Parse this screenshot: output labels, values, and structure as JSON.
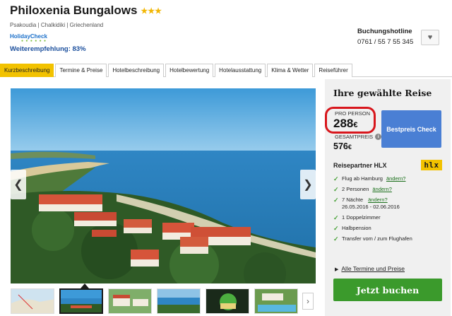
{
  "hotel": {
    "name": "Philoxenia Bungalows",
    "stars": "★★★",
    "location": "Psakoudia | Chalkidiki | Griechenland",
    "holidaycheck_logo": "HolidayCheck",
    "recommendation": "Weiterempfehlung: 83%"
  },
  "hotline": {
    "label": "Buchungshotline",
    "number": "0761 / 55 7 55 345"
  },
  "icons": {
    "favorite": "heart-icon",
    "prev": "chevron-left-icon",
    "next": "chevron-right-icon",
    "info": "info-icon",
    "check": "checkmark-icon"
  },
  "tabs": [
    {
      "label": "Kurzbeschreibung",
      "active": true
    },
    {
      "label": "Termine & Preise"
    },
    {
      "label": "Hotelbeschreibung"
    },
    {
      "label": "Hotelbewertung"
    },
    {
      "label": "Hotelausstattung"
    },
    {
      "label": "Klima & Wetter"
    },
    {
      "label": "Reiseführer"
    }
  ],
  "panel": {
    "title": "Ihre gewählte Reise",
    "per_person_label": "PRO PERSON",
    "per_person_price": "288",
    "currency": "€",
    "total_label": "GESAMTPREIS",
    "total_price": "576",
    "bestpreis_button": "Bestpreis Check",
    "partner": "Reisepartner HLX",
    "partner_logo": "hlx",
    "features": {
      "flight": "Flug ab Hamburg",
      "flight_link": "ändern?",
      "persons": "2 Personen",
      "persons_link": "ändern?",
      "nights": "7 Nächte",
      "nights_link": "ändern?",
      "dates": "26.05.2016 - 02.06.2016",
      "room": "1 Doppelzimmer",
      "board": "Halbpension",
      "transfer": "Transfer vom / zum Flughafen"
    },
    "all_dates_link": "Alle Termine und Preise",
    "book_button": "Jetzt buchen"
  },
  "colors": {
    "tab_active": "#f2c200",
    "price_highlight": "#d8161c",
    "bestpreis": "#4a7fd4",
    "book": "#3b9a2c",
    "check": "#4aa33a",
    "recommendation": "#1a4e9c"
  }
}
